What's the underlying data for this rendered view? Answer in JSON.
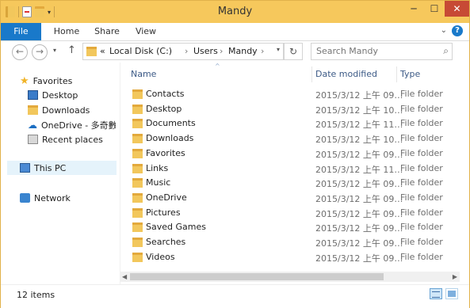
{
  "window": {
    "title": "Mandy",
    "accent": "#f6c85c"
  },
  "qat": [
    {
      "icon": "folder-icon"
    },
    {
      "icon": "properties-icon"
    },
    {
      "icon": "new-folder-icon"
    },
    {
      "icon": "customize-arrow-icon"
    }
  ],
  "ribbon": {
    "tabs": [
      "File",
      "Home",
      "Share",
      "View"
    ]
  },
  "address": {
    "crumbs": [
      "«",
      "Local Disk (C:)",
      "›",
      "Users",
      "›",
      "Mandy",
      "›"
    ]
  },
  "search": {
    "placeholder": "Search Mandy"
  },
  "nav": {
    "favorites": "Favorites",
    "desktop": "Desktop",
    "downloads": "Downloads",
    "onedrive": "OneDrive - 多奇數位",
    "recent": "Recent places",
    "thispc": "This PC",
    "network": "Network"
  },
  "columns": {
    "name": "Name",
    "date": "Date modified",
    "type": "Type"
  },
  "files": [
    {
      "name": "Contacts",
      "date": "2015/3/12 上午 09…",
      "type": "File folder"
    },
    {
      "name": "Desktop",
      "date": "2015/3/12 上午 10…",
      "type": "File folder"
    },
    {
      "name": "Documents",
      "date": "2015/3/12 上午 11…",
      "type": "File folder"
    },
    {
      "name": "Downloads",
      "date": "2015/3/12 上午 10…",
      "type": "File folder"
    },
    {
      "name": "Favorites",
      "date": "2015/3/12 上午 09…",
      "type": "File folder"
    },
    {
      "name": "Links",
      "date": "2015/3/12 上午 11…",
      "type": "File folder"
    },
    {
      "name": "Music",
      "date": "2015/3/12 上午 09…",
      "type": "File folder"
    },
    {
      "name": "OneDrive",
      "date": "2015/3/12 上午 09…",
      "type": "File folder"
    },
    {
      "name": "Pictures",
      "date": "2015/3/12 上午 09…",
      "type": "File folder"
    },
    {
      "name": "Saved Games",
      "date": "2015/3/12 上午 09…",
      "type": "File folder"
    },
    {
      "name": "Searches",
      "date": "2015/3/12 上午 09…",
      "type": "File folder"
    },
    {
      "name": "Videos",
      "date": "2015/3/12 上午 09…",
      "type": "File folder"
    }
  ],
  "status": {
    "count": "12 items"
  }
}
